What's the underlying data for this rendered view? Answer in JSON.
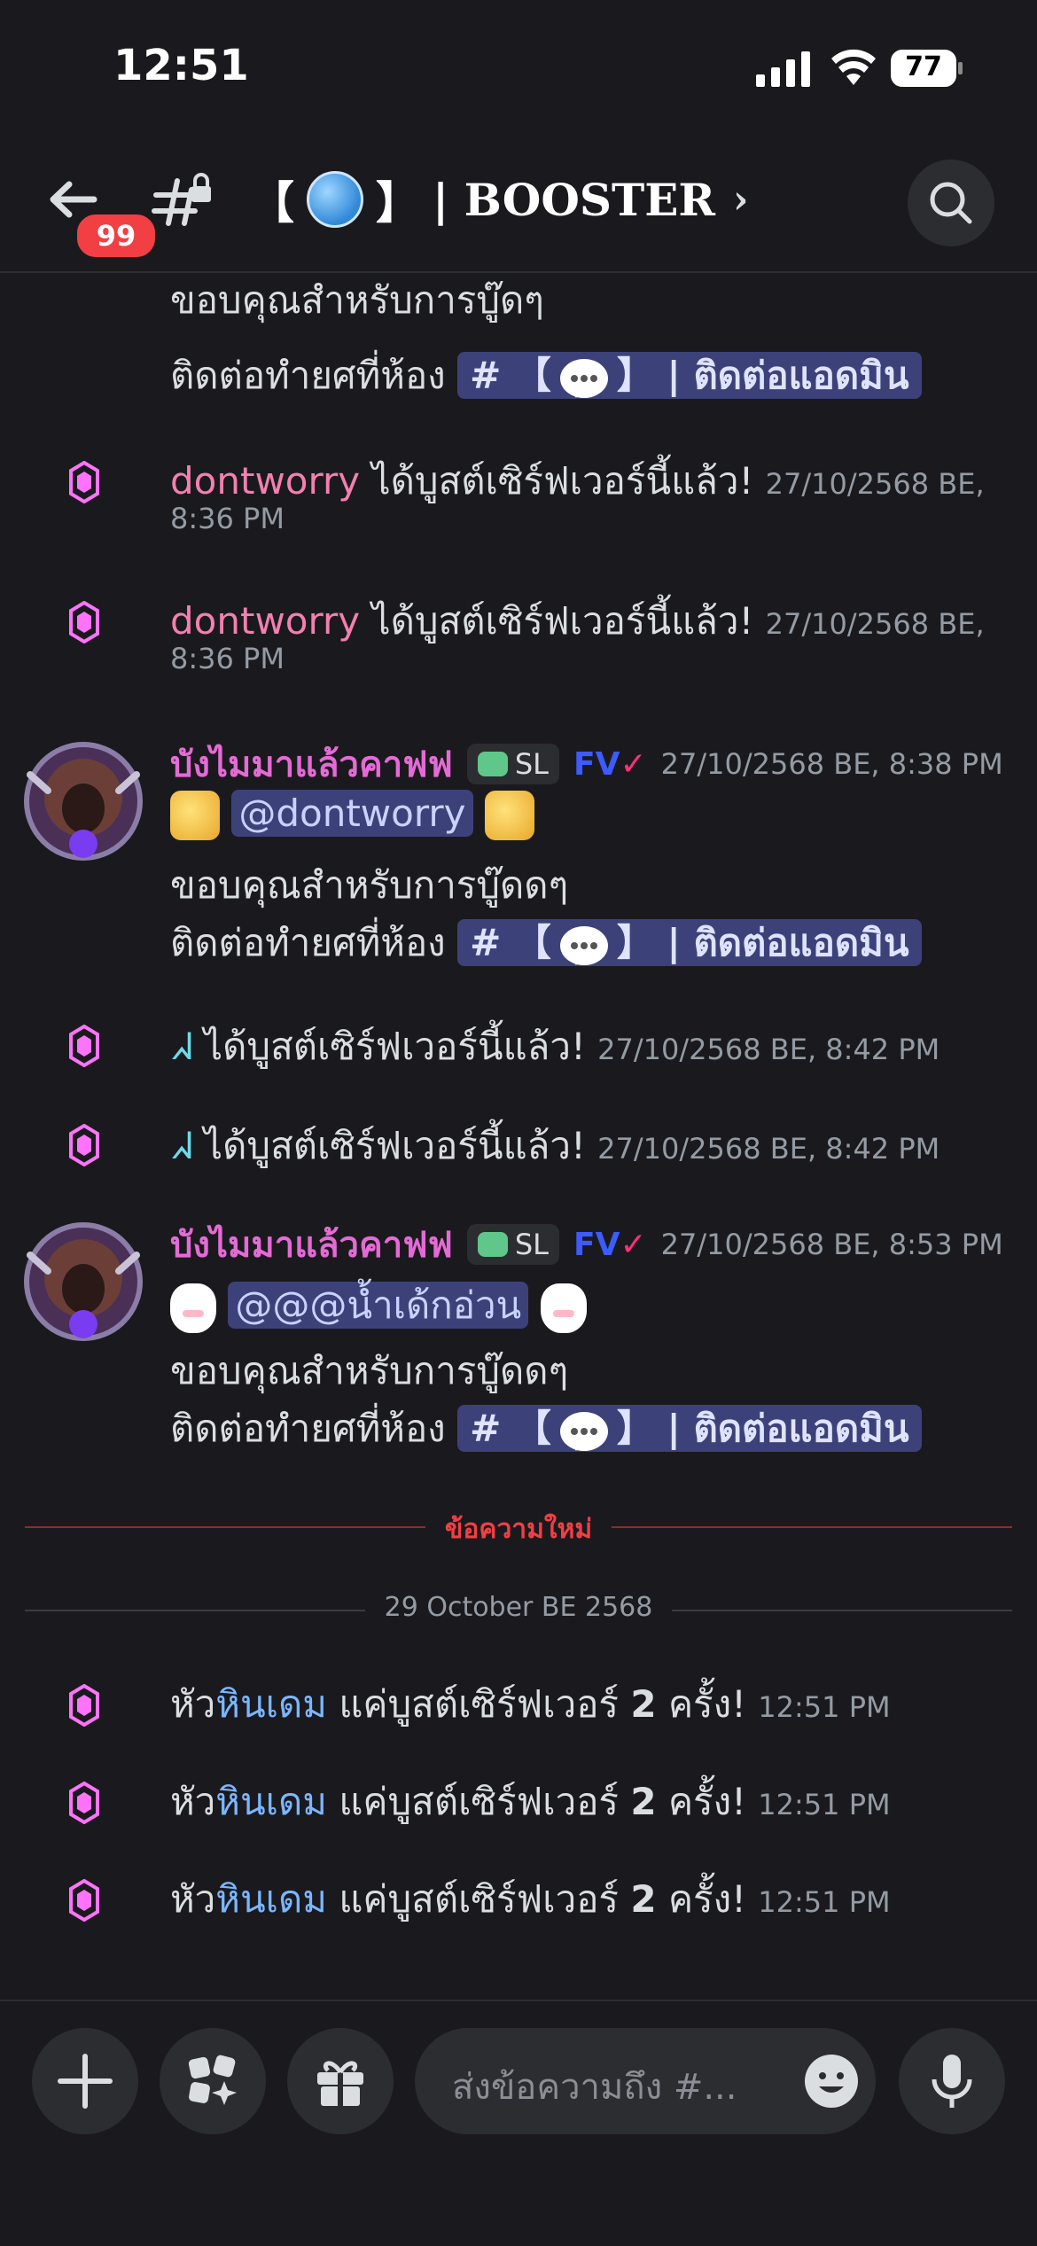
{
  "status_bar": {
    "time": "12:51",
    "battery": "77"
  },
  "header": {
    "back_badge": "99",
    "channel_bracket_open": "【",
    "channel_bracket_close": "】",
    "channel_title": "| BOOSTER",
    "chevron": "›"
  },
  "partial_message": {
    "line1": "ขอบคุณสำหรับการบู๊ดๆ",
    "line2_prefix": "ติดต่อทำยศที่ห้อง",
    "channel_hash": "#",
    "channel_bracket_open": "【",
    "channel_bracket_close": "】",
    "channel_name": "| ติดต่อแอดมิน"
  },
  "boosts_1": [
    {
      "user": "dontworry",
      "text": "ได้บูสต์เซิร์ฟเวอร์นี้แล้ว!",
      "time": "27/10/2568 BE,",
      "time2": "8:36 PM"
    },
    {
      "user": "dontworry",
      "text": "ได้บูสต์เซิร์ฟเวอร์นี้แล้ว!",
      "time": "27/10/2568 BE,",
      "time2": "8:36 PM"
    }
  ],
  "message_1": {
    "author": "บังไมมาแล้วคาฟฟ",
    "tag": "SL",
    "fv": "FV",
    "fv_check": "✓",
    "time": "27/10/2568 BE, 8:38 PM",
    "mention": "@dontworry",
    "line2": "ขอบคุณสำหรับการบู๊ดดๆ",
    "line3_prefix": "ติดต่อทำยศที่ห้อง",
    "channel_hash": "#",
    "channel_bracket_open": "【",
    "channel_bracket_close": "】",
    "channel_name": "| ติดต่อแอดมิน"
  },
  "boosts_2": [
    {
      "user": "ᖽ",
      "text": "ได้บูสต์เซิร์ฟเวอร์นี้แล้ว!",
      "time": "27/10/2568 BE, 8:42 PM"
    },
    {
      "user": "ᖽ",
      "text": "ได้บูสต์เซิร์ฟเวอร์นี้แล้ว!",
      "time": "27/10/2568 BE, 8:42 PM"
    }
  ],
  "message_2": {
    "author": "บังไมมาแล้วคาฟฟ",
    "tag": "SL",
    "fv": "FV",
    "fv_check": "✓",
    "time": "27/10/2568 BE, 8:53 PM",
    "mention": "@@@น้ำเด้กอ่วน",
    "line2": "ขอบคุณสำหรับการบู๊ดดๆ",
    "line3_prefix": "ติดต่อทำยศที่ห้อง",
    "channel_hash": "#",
    "channel_bracket_open": "【",
    "channel_bracket_close": "】",
    "channel_name": "| ติดต่อแอดมิน"
  },
  "new_messages_label": "ข้อความใหม่",
  "date_divider": "29 October BE 2568",
  "boosts_3": [
    {
      "user_a": "หัว",
      "user_b": "หินเดม",
      "text": "แค่บูสต์เซิร์ฟเวอร์",
      "count": "2",
      "text2": "ครั้ง!",
      "time": "12:51 PM"
    },
    {
      "user_a": "หัว",
      "user_b": "หินเดม",
      "text": "แค่บูสต์เซิร์ฟเวอร์",
      "count": "2",
      "text2": "ครั้ง!",
      "time": "12:51 PM"
    },
    {
      "user_a": "หัว",
      "user_b": "หินเดม",
      "text": "แค่บูสต์เซิร์ฟเวอร์",
      "count": "2",
      "text2": "ครั้ง!",
      "time": "12:51 PM"
    }
  ],
  "composer": {
    "placeholder": "ส่งข้อความถึง #..."
  },
  "colors": {
    "background": "#1a1a1e",
    "boost_pink": "#ff73fa",
    "author_pink": "#e56ad6",
    "mention_bg": "#3c4279",
    "new_divider": "#f23f43"
  }
}
